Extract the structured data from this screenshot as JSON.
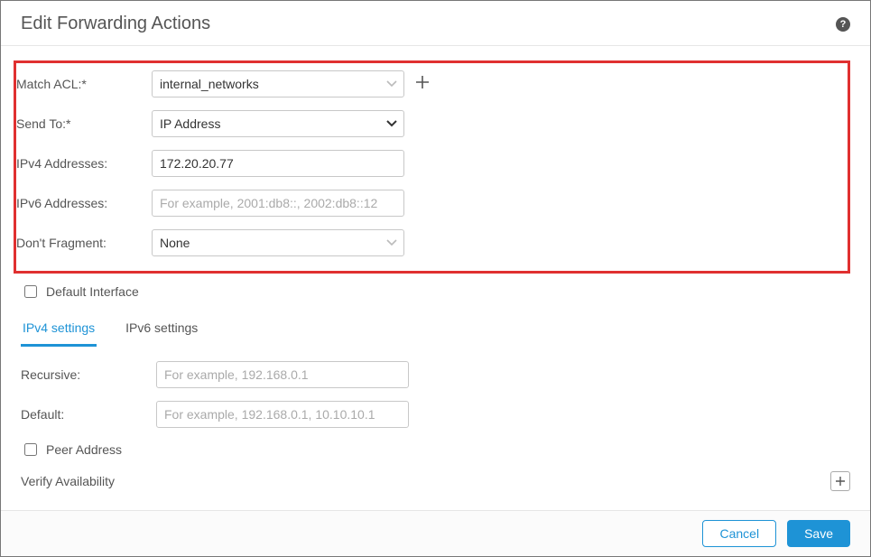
{
  "title": "Edit Forwarding Actions",
  "fields": {
    "match_acl": {
      "label": "Match ACL:*",
      "value": "internal_networks"
    },
    "send_to": {
      "label": "Send To:*",
      "value": "IP Address"
    },
    "ipv4": {
      "label": "IPv4 Addresses:",
      "value": "172.20.20.77"
    },
    "ipv6": {
      "label": "IPv6 Addresses:",
      "placeholder": "For example, 2001:db8::, 2002:db8::12"
    },
    "dont_fragment": {
      "label": "Don't Fragment:",
      "value": "None"
    }
  },
  "default_interface": {
    "label": "Default Interface",
    "checked": false
  },
  "tabs": {
    "ipv4": "IPv4 settings",
    "ipv6": "IPv6 settings",
    "active": "ipv4"
  },
  "ipv4_settings": {
    "recursive": {
      "label": "Recursive:",
      "placeholder": "For example, 192.168.0.1"
    },
    "default": {
      "label": "Default:",
      "placeholder": "For example, 192.168.0.1, 10.10.10.1"
    }
  },
  "peer_address": {
    "label": "Peer Address",
    "checked": false
  },
  "verify_availability": {
    "label": "Verify Availability"
  },
  "footer": {
    "cancel": "Cancel",
    "save": "Save"
  }
}
